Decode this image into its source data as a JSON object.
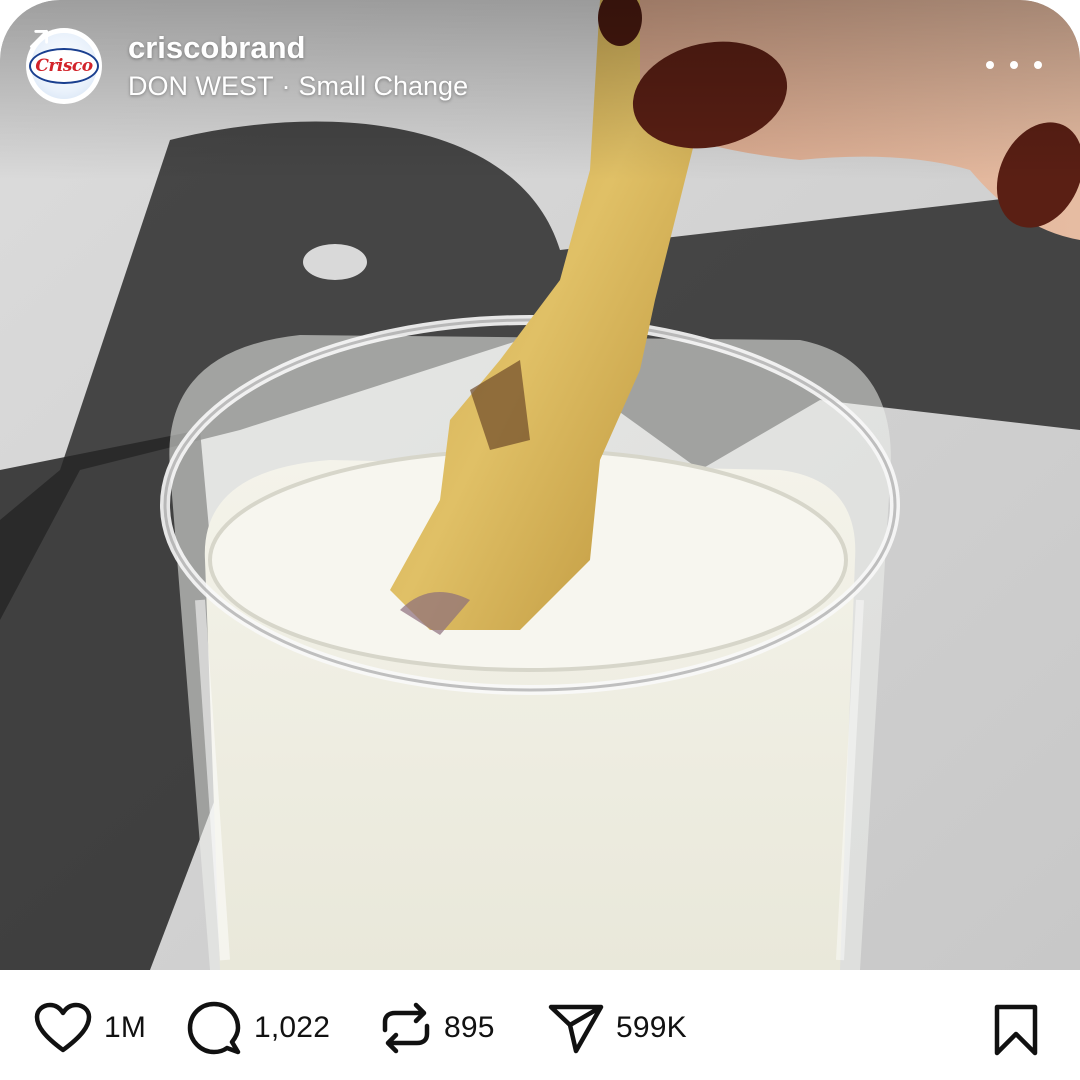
{
  "post": {
    "account": {
      "username": "criscobrand",
      "avatar_logo_text": "Crisco"
    },
    "audio": {
      "artist": "DON WEST",
      "separator": "·",
      "track": "Small Change",
      "icon": "arrow-up-right-icon"
    },
    "more_icon": "more-horizontal-icon",
    "media_description_icon": "photo"
  },
  "actions": {
    "like": {
      "icon": "heart-icon",
      "count": "1M"
    },
    "comment": {
      "icon": "comment-icon",
      "count": "1,022"
    },
    "repost": {
      "icon": "repost-icon",
      "count": "895"
    },
    "share": {
      "icon": "send-icon",
      "count": "599K"
    },
    "save": {
      "icon": "bookmark-icon"
    }
  },
  "colors": {
    "background": "#ffffff",
    "text": "#111111",
    "overlay_text": "#ffffff",
    "brand_red": "#d2232a",
    "brand_blue": "#1a3f8f"
  }
}
